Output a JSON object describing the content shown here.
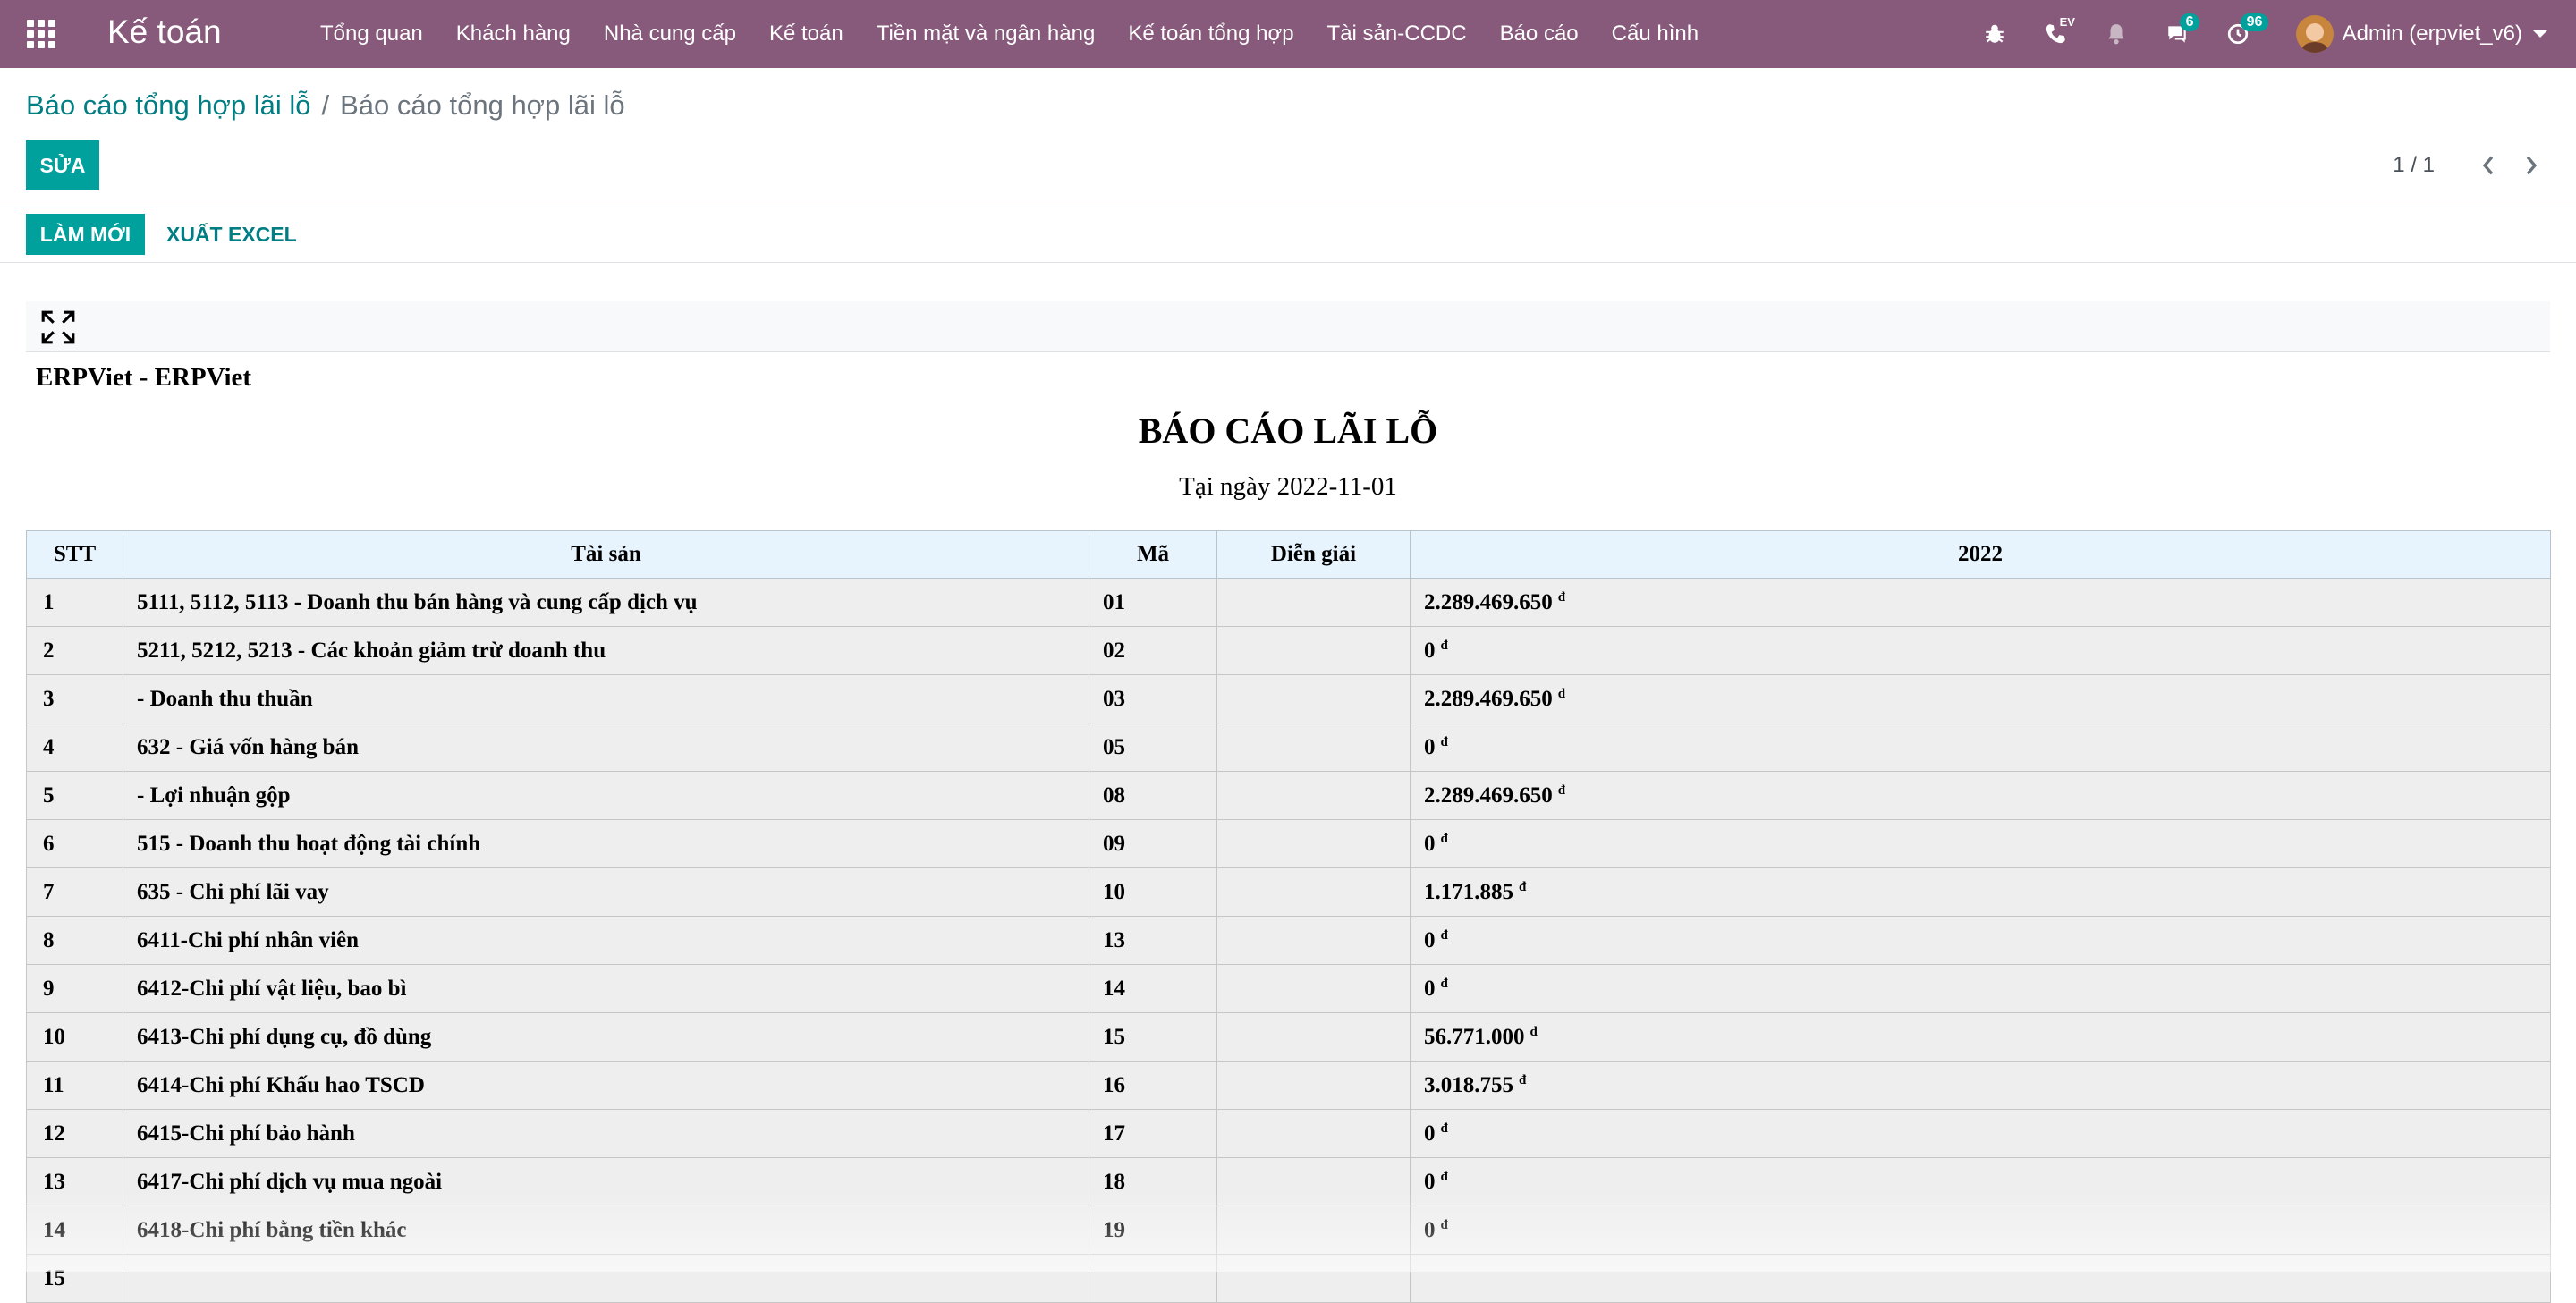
{
  "navbar": {
    "brand": "Kế toán",
    "menu": [
      "Tổng quan",
      "Khách hàng",
      "Nhà cung cấp",
      "Kế toán",
      "Tiền mặt và ngân hàng",
      "Kế toán tổng hợp",
      "Tài sản-CCDC",
      "Báo cáo",
      "Cấu hình"
    ],
    "phone_label": "EV",
    "messages_count": "6",
    "activities_count": "96",
    "user_name": "Admin (erpviet_v6)",
    "color": "#875a7b"
  },
  "breadcrumb": {
    "parent": "Báo cáo tổng hợp lãi lỗ",
    "separator": "/",
    "current": "Báo cáo tổng hợp lãi lỗ"
  },
  "buttons": {
    "edit": "SỬA",
    "refresh": "LÀM MỚI",
    "export_excel": "XUẤT EXCEL"
  },
  "pager": {
    "value": "1 / 1"
  },
  "report": {
    "company": "ERPViet - ERPViet",
    "title": "BÁO CÁO LÃI LỖ",
    "date_line": "Tại ngày 2022-11-01",
    "columns": [
      "STT",
      "Tài sản",
      "Mã",
      "Diễn giải",
      "2022"
    ],
    "currency_symbol": "đ",
    "rows": [
      {
        "stt": "1",
        "name": "5111, 5112, 5113 - Doanh thu bán hàng và cung cấp dịch vụ",
        "code": "01",
        "desc": "",
        "value": "2.289.469.650"
      },
      {
        "stt": "2",
        "name": "5211, 5212, 5213 - Các khoản giảm trừ doanh thu",
        "code": "02",
        "desc": "",
        "value": "0"
      },
      {
        "stt": "3",
        "name": "- Doanh thu thuần",
        "code": "03",
        "desc": "",
        "value": "2.289.469.650"
      },
      {
        "stt": "4",
        "name": "632 - Giá vốn hàng bán",
        "code": "05",
        "desc": "",
        "value": "0"
      },
      {
        "stt": "5",
        "name": "- Lợi nhuận gộp",
        "code": "08",
        "desc": "",
        "value": "2.289.469.650"
      },
      {
        "stt": "6",
        "name": "515 - Doanh thu hoạt động tài chính",
        "code": "09",
        "desc": "",
        "value": "0"
      },
      {
        "stt": "7",
        "name": "635 - Chi phí lãi vay",
        "code": "10",
        "desc": "",
        "value": "1.171.885"
      },
      {
        "stt": "8",
        "name": "6411-Chi phí nhân viên",
        "code": "13",
        "desc": "",
        "value": "0"
      },
      {
        "stt": "9",
        "name": "6412-Chi phí vật liệu, bao bì",
        "code": "14",
        "desc": "",
        "value": "0"
      },
      {
        "stt": "10",
        "name": "6413-Chi phí dụng cụ, đồ dùng",
        "code": "15",
        "desc": "",
        "value": "56.771.000"
      },
      {
        "stt": "11",
        "name": "6414-Chi phí Khấu hao TSCD",
        "code": "16",
        "desc": "",
        "value": "3.018.755"
      },
      {
        "stt": "12",
        "name": "6415-Chi phí bảo hành",
        "code": "17",
        "desc": "",
        "value": "0"
      },
      {
        "stt": "13",
        "name": "6417-Chi phí dịch vụ mua ngoài",
        "code": "18",
        "desc": "",
        "value": "0"
      },
      {
        "stt": "14",
        "name": "6418-Chi phí bằng tiền khác",
        "code": "19",
        "desc": "",
        "value": "0"
      },
      {
        "stt": "15",
        "name": "",
        "code": "",
        "desc": "",
        "value": ""
      }
    ]
  }
}
